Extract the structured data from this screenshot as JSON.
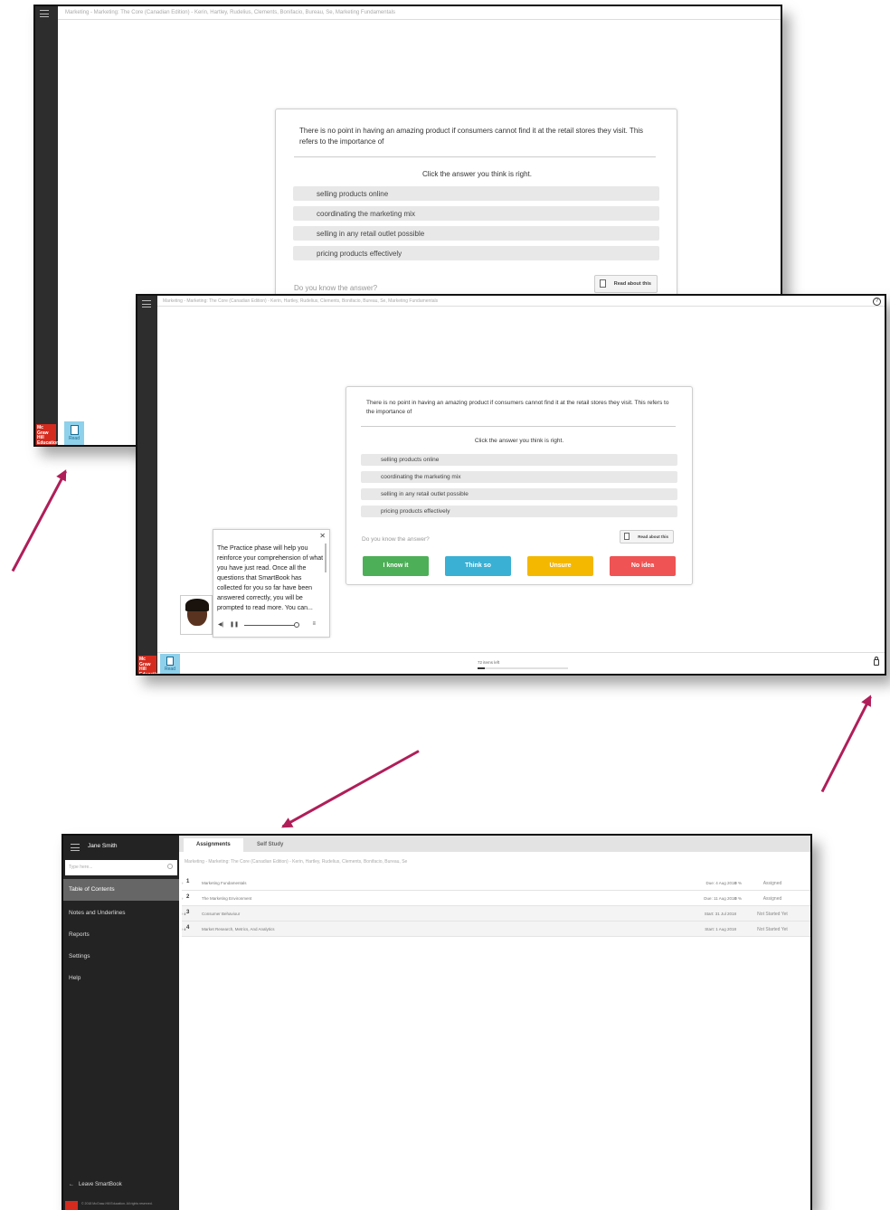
{
  "book_title": "Marketing - Marketing: The Core (Canadian Edition) - Kerin, Hartley, Rudelius, Clements, Bonifacio, Bureau, Se, Marketing Fundamentals",
  "logo_text": [
    "Mc",
    "Graw",
    "Hill",
    "Education"
  ],
  "read_tab_label": "Read",
  "question": {
    "text": "There is no point in having an amazing product if consumers cannot find it at the retail stores they visit. This refers to the importance of",
    "instruction": "Click the answer you think is right.",
    "options": [
      "selling products online",
      "coordinating the marketing mix",
      "selling in any retail outlet possible",
      "pricing products effectively"
    ],
    "do_you_know": "Do you know the answer?",
    "read_about": "Read about this"
  },
  "confidence_buttons": [
    {
      "label": "I know it",
      "color": "#4daf57"
    },
    {
      "label": "Think so",
      "color": "#39b0d4"
    },
    {
      "label": "Unsure",
      "color": "#f4b800"
    },
    {
      "label": "No idea",
      "color": "#ef5353"
    }
  ],
  "tutor": {
    "message": "The Practice phase will help you reinforce your comprehension of what you have just read. Once all the questions that SmartBook has collected for you so far have been answered correctly, you will be prompted to read more. You can...",
    "close_symbol": "✕"
  },
  "progress": {
    "label": "72 items left",
    "fraction": 0.08
  },
  "sidebar": {
    "user_name": "Jane Smith",
    "search_placeholder": "Type here...",
    "items": [
      "Table of Contents",
      "Notes and Underlines",
      "Reports",
      "Settings",
      "Help"
    ],
    "active_index": 0,
    "leave_label": "Leave SmartBook",
    "copyright": "© 2018 McGraw-Hill Education. All rights reserved."
  },
  "tabs": [
    "Assignments",
    "Self Study"
  ],
  "course_title": "Marketing - Marketing: The Core (Canadian Edition) - Kerin, Hartley, Rudelius, Clements, Bonifacio, Bureau, Se",
  "assignments": [
    {
      "num": "1",
      "title": "Marketing Fundamentals",
      "date": "Due: 4 Aug 2018",
      "pct": "0 %",
      "status": "Assigned",
      "action": "›",
      "shaded": false
    },
    {
      "num": "2",
      "title": "The Marketing Environment",
      "date": "Due: 11 Aug 2018",
      "pct": "0 %",
      "status": "Assigned",
      "action": "›",
      "shaded": false
    },
    {
      "num": "3",
      "title": "Consumer Behaviour",
      "date": "Start: 31 Jul 2018",
      "pct": "",
      "status": "Not Started Yet",
      "action": "›↡",
      "shaded": true
    },
    {
      "num": "4",
      "title": "Market Research, Metrics, And Analytics",
      "date": "Start: 1 Aug 2018",
      "pct": "",
      "status": "Not Started Yet",
      "action": "›↡",
      "shaded": true
    }
  ],
  "colors": {
    "arrow": "#b01e59",
    "brand_red": "#d52b1e",
    "read_tab": "#8fd0ea",
    "sidebar": "#232323"
  }
}
